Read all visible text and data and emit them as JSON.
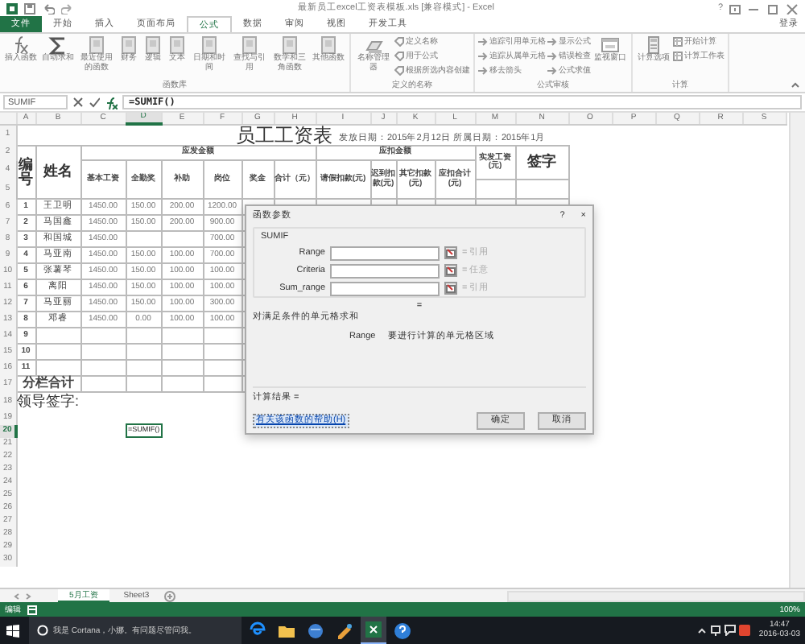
{
  "window": {
    "title": "最新员工excel工资表模板.xls [兼容模式] - Excel",
    "help": "?",
    "login": "登录"
  },
  "ribbon_tabs": [
    {
      "label": "文件",
      "kind": "file",
      "selected": false
    },
    {
      "label": "开始",
      "kind": "tab",
      "selected": false
    },
    {
      "label": "插入",
      "kind": "tab",
      "selected": false
    },
    {
      "label": "页面布局",
      "kind": "tab",
      "selected": false
    },
    {
      "label": "公式",
      "kind": "tab",
      "selected": true
    },
    {
      "label": "数据",
      "kind": "tab",
      "selected": false
    },
    {
      "label": "审阅",
      "kind": "tab",
      "selected": false
    },
    {
      "label": "视图",
      "kind": "tab",
      "selected": false
    },
    {
      "label": "开发工具",
      "kind": "tab",
      "selected": false
    }
  ],
  "ribbon_groups": [
    {
      "label": "函数库",
      "buttons": [
        {
          "kind": "large",
          "label": "插入函数"
        },
        {
          "kind": "large",
          "label": "自动求和"
        },
        {
          "kind": "large",
          "label": "最近使用的函数"
        },
        {
          "kind": "large",
          "label": "财务"
        },
        {
          "kind": "large",
          "label": "逻辑"
        },
        {
          "kind": "large",
          "label": "文本"
        },
        {
          "kind": "large",
          "label": "日期和时间"
        },
        {
          "kind": "large",
          "label": "查找与引用"
        },
        {
          "kind": "large",
          "label": "数学和三角函数"
        },
        {
          "kind": "large",
          "label": "其他函数"
        }
      ]
    },
    {
      "label": "定义的名称",
      "buttons": [
        {
          "kind": "large",
          "label": "名称管理器"
        },
        {
          "kind": "small",
          "label": "定义名称"
        },
        {
          "kind": "small",
          "label": "用于公式"
        },
        {
          "kind": "small",
          "label": "根据所选内容创建"
        }
      ]
    },
    {
      "label": "公式审核",
      "buttons": [
        {
          "kind": "small",
          "label": "追踪引用单元格"
        },
        {
          "kind": "small",
          "label": "追踪从属单元格"
        },
        {
          "kind": "small",
          "label": "移去箭头"
        },
        {
          "kind": "small",
          "label": "显示公式"
        },
        {
          "kind": "small",
          "label": "错误检查"
        },
        {
          "kind": "small",
          "label": "公式求值"
        },
        {
          "kind": "large",
          "label": "监视窗口"
        }
      ]
    },
    {
      "label": "计算",
      "buttons": [
        {
          "kind": "large",
          "label": "计算选项"
        },
        {
          "kind": "small",
          "label": "开始计算"
        },
        {
          "kind": "small",
          "label": "计算工作表"
        }
      ]
    }
  ],
  "formula_bar": {
    "name_box": "SUMIF",
    "formula": "=SUMIF()"
  },
  "columns": [
    {
      "label": "A",
      "selected": false
    },
    {
      "label": "B",
      "selected": false
    },
    {
      "label": "C",
      "selected": false
    },
    {
      "label": "D",
      "selected": true
    },
    {
      "label": "E",
      "selected": false
    },
    {
      "label": "F",
      "selected": false
    },
    {
      "label": "G",
      "selected": false
    },
    {
      "label": "H",
      "selected": false
    },
    {
      "label": "I",
      "selected": false
    },
    {
      "label": "J",
      "selected": false
    },
    {
      "label": "K",
      "selected": false
    },
    {
      "label": "L",
      "selected": false
    },
    {
      "label": "M",
      "selected": false
    },
    {
      "label": "N",
      "selected": false
    },
    {
      "label": "O",
      "selected": false
    },
    {
      "label": "P",
      "selected": false
    },
    {
      "label": "Q",
      "selected": false
    },
    {
      "label": "R",
      "selected": false
    },
    {
      "label": "S",
      "selected": false
    }
  ],
  "row_numbers": [
    {
      "label": "1",
      "selected": false
    },
    {
      "label": "2",
      "selected": false
    },
    {
      "label": "4",
      "selected": false
    },
    {
      "label": "5",
      "selected": false
    },
    {
      "label": "6",
      "selected": false
    },
    {
      "label": "7",
      "selected": false
    },
    {
      "label": "8",
      "selected": false
    },
    {
      "label": "9",
      "selected": false
    },
    {
      "label": "10",
      "selected": false
    },
    {
      "label": "11",
      "selected": false
    },
    {
      "label": "12",
      "selected": false
    },
    {
      "label": "13",
      "selected": false
    },
    {
      "label": "14",
      "selected": false
    },
    {
      "label": "15",
      "selected": false
    },
    {
      "label": "16",
      "selected": false
    },
    {
      "label": "17",
      "selected": false
    },
    {
      "label": "18",
      "selected": false
    },
    {
      "label": "19",
      "selected": false
    },
    {
      "label": "20",
      "selected": true
    },
    {
      "label": "21",
      "selected": false
    },
    {
      "label": "22",
      "selected": false
    },
    {
      "label": "23",
      "selected": false
    },
    {
      "label": "24",
      "selected": false
    },
    {
      "label": "25",
      "selected": false
    },
    {
      "label": "26",
      "selected": false
    },
    {
      "label": "27",
      "selected": false
    },
    {
      "label": "28",
      "selected": false
    },
    {
      "label": "29",
      "selected": false
    },
    {
      "label": "30",
      "selected": false
    }
  ],
  "sheet": {
    "title": "员工工资表",
    "dates": "发放日期：2015年2月12日 所属日期：2015年1月",
    "header": {
      "number": "编号",
      "name": "姓名",
      "pay_group": "应发金额",
      "pay_columns": [
        "基本工资",
        "全勤奖",
        "补助",
        "岗位",
        "奖金",
        "合计（元）"
      ],
      "deduct_group": "应扣金额",
      "deduct_columns": [
        "请假扣款(元)",
        "迟到扣款(元)",
        "其它扣款(元)",
        "应扣合计(元)"
      ],
      "net": "实发工资(元)",
      "sign": "签字"
    },
    "employees": [
      {
        "number": "1",
        "name": "王卫明",
        "base": "1450.00",
        "attendance": "150.00",
        "allowance": "200.00",
        "post": "1200.00"
      },
      {
        "number": "2",
        "name": "马国鑫",
        "base": "1450.00",
        "attendance": "150.00",
        "allowance": "200.00",
        "post": "900.00"
      },
      {
        "number": "3",
        "name": "和国城",
        "base": "1450.00",
        "post": "700.00"
      },
      {
        "number": "4",
        "name": "马亚南",
        "base": "1450.00",
        "attendance": "150.00",
        "allowance": "100.00",
        "post": "700.00"
      },
      {
        "number": "5",
        "name": "张薯琴",
        "base": "1450.00",
        "attendance": "150.00",
        "allowance": "100.00",
        "post": "100.00"
      },
      {
        "number": "6",
        "name": "离阳",
        "base": "1450.00",
        "attendance": "150.00",
        "allowance": "100.00",
        "post": "100.00"
      },
      {
        "number": "7",
        "name": "马亚丽",
        "base": "1450.00",
        "attendance": "150.00",
        "allowance": "100.00",
        "post": "300.00"
      },
      {
        "number": "8",
        "name": "邓睿",
        "base": "1450.00",
        "attendance": "0.00",
        "allowance": "100.00",
        "post": "100.00"
      }
    ],
    "blank_numbers": [
      "9",
      "10",
      "11"
    ],
    "subtotal_label": "分栏合计",
    "signature_label": "领导签字:",
    "active_cell_value": "=SUMIF()"
  },
  "dialog": {
    "title": "函数参数",
    "help": "?",
    "close": "×",
    "function": "SUMIF",
    "arguments": [
      {
        "label": "Range",
        "result": "= 引用"
      },
      {
        "label": "Criteria",
        "result": "= 任意"
      },
      {
        "label": "Sum_range",
        "result": "= 引用"
      }
    ],
    "equals": "=",
    "description": "对满足条件的单元格求和",
    "argument_name": "Range",
    "argument_help": "要进行计算的单元格区域",
    "result_label": "计算结果 =",
    "help_link": "有关该函数的帮助(H)",
    "buttons": [
      "确定",
      "取消"
    ]
  },
  "sheet_tabs": [
    {
      "label": "5月工资",
      "selected": true
    },
    {
      "label": "Sheet3",
      "selected": false
    }
  ],
  "status_bar": {
    "mode": "编辑",
    "zoom": "100%"
  },
  "taskbar": {
    "search": "我是 Cortana，小娜。有问题尽管问我。",
    "time": "14:47",
    "date": "2016-03-03"
  }
}
